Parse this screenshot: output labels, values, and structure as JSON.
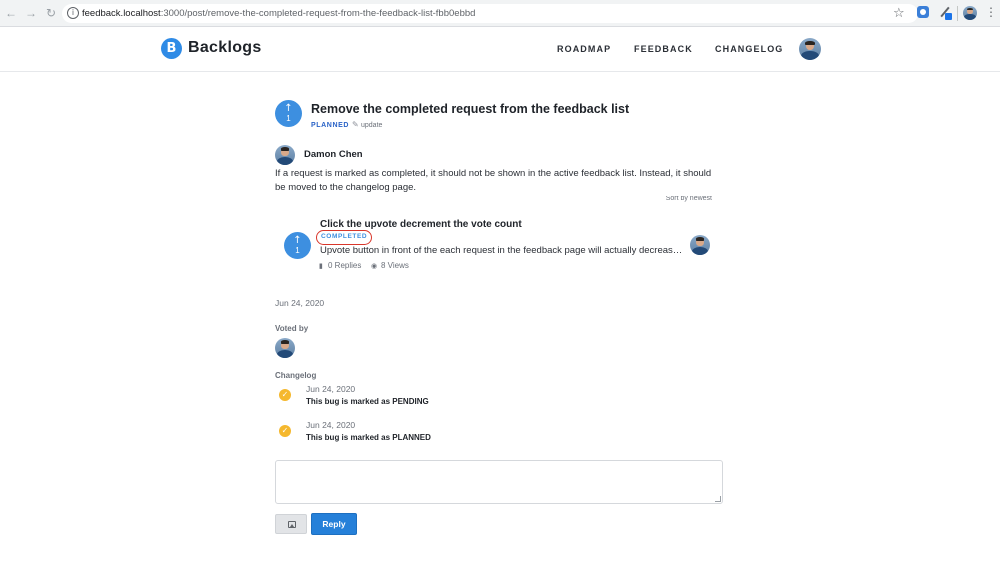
{
  "browser": {
    "url_host": "feedback.localhost",
    "url_path": ":3000/post/remove-the-completed-request-from-the-feedback-list-fbb0ebbd"
  },
  "header": {
    "logo_letter": "B",
    "brand": "Backlogs",
    "nav": [
      "ROADMAP",
      "FEEDBACK",
      "CHANGELOG"
    ]
  },
  "post": {
    "votes": "1",
    "title": "Remove the completed request from the feedback list",
    "status": "PLANNED",
    "update_label": "update",
    "author": "Damon Chen",
    "body": "If a request is marked as completed, it should not be shown in the active feedback list. Instead, it should be moved to the changelog page.",
    "date": "Jun 24, 2020"
  },
  "sort_label": "Sort by newest",
  "linked_card": {
    "votes": "1",
    "title": "Click the upvote decrement the vote count",
    "status": "COMPLETED",
    "excerpt": "Upvote button in front of the each request in the feedback page will actually decrease the vote count",
    "replies": "0 Replies",
    "views": "8 Views"
  },
  "voted_by": {
    "label": "Voted by"
  },
  "changelog": {
    "label": "Changelog",
    "entries": [
      {
        "date": "Jun 24, 2020",
        "text": "This bug is marked as PENDING"
      },
      {
        "date": "Jun 24, 2020",
        "text": "This bug is marked as PLANNED"
      }
    ]
  },
  "composer": {
    "placeholder": "",
    "reply_label": "Reply"
  },
  "colors": {
    "accent": "#2580d9",
    "vote": "#3d8fe0",
    "planned": "#2a63c7",
    "highlight_ring": "#d9362b",
    "changelog_check": "#f5b82e"
  }
}
